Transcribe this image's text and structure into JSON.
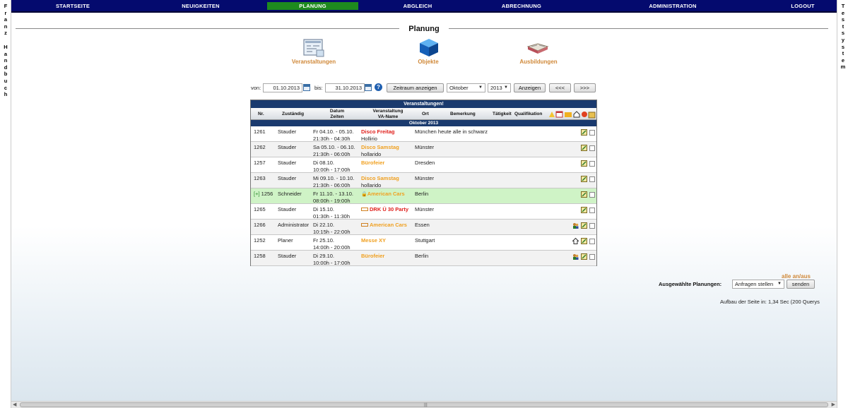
{
  "nav": {
    "items": [
      {
        "label": "STARTSEITE",
        "active": false
      },
      {
        "label": "NEUIGKEITEN",
        "active": false
      },
      {
        "label": "PLANUNG",
        "active": true
      },
      {
        "label": "ABGLEICH",
        "active": false
      },
      {
        "label": "ABRECHNUNG",
        "active": false
      },
      {
        "label": "ADMINISTRATION",
        "active": false
      },
      {
        "label": "LOGOUT",
        "active": false
      }
    ]
  },
  "left_strip": {
    "line1": "F\nr\na\nn\nz",
    "line2": "H\na\nn\nd\nb\nu\nc\nh"
  },
  "right_strip": {
    "text": "T\ne\ns\nt\ns\ny\ns\nt\ne\nm"
  },
  "page_title": "Planung",
  "shortcuts": [
    {
      "label": "Veranstaltungen",
      "icon": "events-icon"
    },
    {
      "label": "Objekte",
      "icon": "cube-icon"
    },
    {
      "label": "Ausbildungen",
      "icon": "book-icon"
    }
  ],
  "filter": {
    "from_label": "von:",
    "from_value": "01.10.2013",
    "to_label": "bis:",
    "to_value": "31.10.2013",
    "range_button": "Zeitraum anzeigen",
    "month_selected": "Oktober",
    "year_selected": "2013",
    "show_button": "Anzeigen",
    "prev_button": "<<<",
    "next_button": ">>>"
  },
  "table": {
    "title": "Veranstaltungen!",
    "columns": {
      "nr": "Nr.",
      "responsible": "Zuständig",
      "date_1": "Datum",
      "date_2": "Zeiten",
      "event_1": "Veranstaltung",
      "event_2": "VA-Name",
      "location": "Ort",
      "remark": "Bemerkung",
      "activity": "Tätigkeit",
      "qualification": "Qualifikation"
    },
    "month_label": "Oktober 2013",
    "rows": [
      {
        "nr": "1261",
        "resp": "Stauder",
        "date": "Fr 04.10. - 05.10.",
        "time": "21:30h - 04:30h",
        "event": "Disco Freitag",
        "event_color": "#e0201c",
        "name": "Hollirio",
        "place": "München heute alle in schwarz",
        "green": false
      },
      {
        "nr": "1262",
        "resp": "Stauder",
        "date": "Sa 05.10. - 06.10.",
        "time": "21:30h - 06:00h",
        "event": "Disco Samstag",
        "event_color": "#f0a020",
        "name": "hollarido",
        "place": "Münster",
        "green": false
      },
      {
        "nr": "1257",
        "resp": "Stauder",
        "date": "Di 08.10.",
        "time": "10:00h - 17:00h",
        "event": "Bürofeier",
        "event_color": "#f0a020",
        "name": "",
        "place": "Dresden",
        "green": false
      },
      {
        "nr": "1263",
        "resp": "Stauder",
        "date": "Mi 09.10. - 10.10.",
        "time": "21:30h - 06:00h",
        "event": "Disco Samstag",
        "event_color": "#f0a020",
        "name": "hollarido",
        "place": "Münster",
        "green": false
      },
      {
        "nr": "1256",
        "prefix": "[+]",
        "resp": "Schneider",
        "date": "Fr 11.10. - 13.10.",
        "time": "08:00h - 19:00h",
        "event": "American Cars",
        "event_color": "#f0a020",
        "name": "",
        "place": "Berlin",
        "green": true
      },
      {
        "nr": "1265",
        "resp": "Stauder",
        "date": "Di 15.10.",
        "time": "01:30h - 11:30h",
        "event": "DRK Ü 30 Party",
        "event_color": "#e0201c",
        "name": "",
        "place": "Münster",
        "green": false
      },
      {
        "nr": "1266",
        "resp": "Administrator",
        "date": "Di 22.10.",
        "time": "10:15h - 22:00h",
        "event": "American Cars",
        "event_color": "#f0a020",
        "name": "",
        "place": "Essen",
        "green": false
      },
      {
        "nr": "1252",
        "resp": "Planer",
        "date": "Fr 25.10.",
        "time": "14:00h - 20:00h",
        "event": "Messe XY",
        "event_color": "#f0a020",
        "name": "",
        "place": "Stuttgart",
        "green": false
      },
      {
        "nr": "1258",
        "resp": "Stauder",
        "date": "Di 29.10.",
        "time": "10:00h - 17:00h",
        "event": "Bürofeier",
        "event_color": "#f0a020",
        "name": "",
        "place": "Berlin",
        "green": false
      }
    ]
  },
  "bottom": {
    "toggle_all": "alle an/aus",
    "selected_label": "Ausgewählte Planungen:",
    "action_selected": "Anfragen stellen",
    "send_button": "senden",
    "build_time": "Aufbau der Seite in: 1,34 Sec (200 Querys"
  }
}
